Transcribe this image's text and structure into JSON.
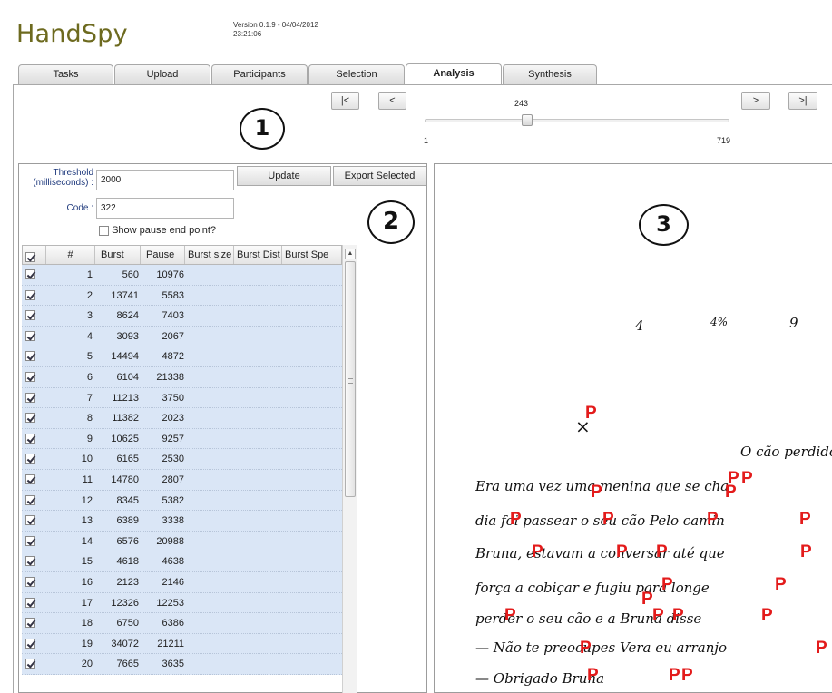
{
  "app": {
    "title": "HandSpy",
    "version_line1": "Version 0.1.9 - 04/04/2012",
    "version_line2": "23:21:06"
  },
  "tabs": [
    {
      "label": "Tasks"
    },
    {
      "label": "Upload"
    },
    {
      "label": "Participants"
    },
    {
      "label": "Selection"
    },
    {
      "label": "Analysis"
    },
    {
      "label": "Synthesis"
    }
  ],
  "active_tab": "Analysis",
  "navigation": {
    "first_label": "|<",
    "prev_label": "<",
    "next_label": ">",
    "last_label": ">|",
    "slider_value": "243",
    "slider_min": "1",
    "slider_max": "719"
  },
  "annotations": {
    "one": "1",
    "two": "2",
    "three": "3"
  },
  "controls": {
    "threshold_label": "Threshold",
    "threshold_unit": "(milliseconds) :",
    "threshold_value": "2000",
    "code_label": "Code :",
    "code_value": "322",
    "update_label": "Update",
    "export_label": "Export Selected",
    "show_pause_label": "Show pause end point?",
    "show_pause_checked": false
  },
  "table": {
    "columns": [
      "",
      "#",
      "Burst",
      "Pause",
      "Burst size",
      "Burst Dist",
      "Burst Spe"
    ],
    "rows": [
      {
        "n": "1",
        "burst": "560",
        "pause": "10976"
      },
      {
        "n": "2",
        "burst": "13741",
        "pause": "5583"
      },
      {
        "n": "3",
        "burst": "8624",
        "pause": "7403"
      },
      {
        "n": "4",
        "burst": "3093",
        "pause": "2067"
      },
      {
        "n": "5",
        "burst": "14494",
        "pause": "4872"
      },
      {
        "n": "6",
        "burst": "6104",
        "pause": "21338"
      },
      {
        "n": "7",
        "burst": "11213",
        "pause": "3750"
      },
      {
        "n": "8",
        "burst": "11382",
        "pause": "2023"
      },
      {
        "n": "9",
        "burst": "10625",
        "pause": "9257"
      },
      {
        "n": "10",
        "burst": "6165",
        "pause": "2530"
      },
      {
        "n": "11",
        "burst": "14780",
        "pause": "2807"
      },
      {
        "n": "12",
        "burst": "8345",
        "pause": "5382"
      },
      {
        "n": "13",
        "burst": "6389",
        "pause": "3338"
      },
      {
        "n": "14",
        "burst": "6576",
        "pause": "20988"
      },
      {
        "n": "15",
        "burst": "4618",
        "pause": "4638"
      },
      {
        "n": "16",
        "burst": "2123",
        "pause": "2146"
      },
      {
        "n": "17",
        "burst": "12326",
        "pause": "12253"
      },
      {
        "n": "18",
        "burst": "6750",
        "pause": "6386"
      },
      {
        "n": "19",
        "burst": "34072",
        "pause": "21211"
      },
      {
        "n": "20",
        "burst": "7665",
        "pause": "3635"
      }
    ]
  },
  "handwriting": {
    "top_marks": [
      "4",
      "4%",
      "9"
    ],
    "cross_mark": "×",
    "title": "O cão perdido",
    "lines": [
      "Era uma vez uma menina que se cha",
      "dia foi passear o seu cão Pelo camin",
      "Bruna, estavam a conversar até que",
      "força a cobiçar e fugiu para longe",
      "perder o seu cão e a Bruna disse",
      "— Não te preocupes Vera eu arranjo",
      "— Obrigado Bruna"
    ],
    "pause_marker_label": "P",
    "marker_color": "#e31b1b"
  },
  "colors": {
    "logo": "#6d6a1f",
    "row_selected": "#dae6f6",
    "label_blue": "#1f3a7d"
  }
}
